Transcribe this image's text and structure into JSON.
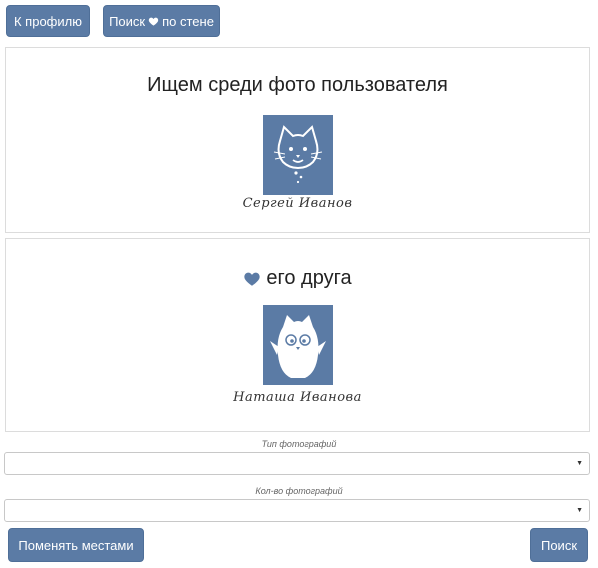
{
  "toolbar": {
    "profile_label": "К профилю",
    "search_wall_prefix": "Поиск",
    "search_wall_suffix": "по стене"
  },
  "user_panel": {
    "title": "Ищем среди фото пользователя",
    "name": "Сергей Иванов",
    "avatar_icon": "cat-face-icon"
  },
  "friend_panel": {
    "title": "его друга",
    "name": "Наташа Иванова",
    "avatar_icon": "owl-cat-icon",
    "heart_icon": "heart-icon"
  },
  "form": {
    "type_label": "Тип фотографий",
    "type_value": "",
    "count_label": "Кол-во фотографий",
    "count_value": ""
  },
  "actions": {
    "swap_label": "Поменять местами",
    "search_label": "Поиск"
  },
  "colors": {
    "accent": "#5b7ba5",
    "border": "#dcdcdc"
  }
}
